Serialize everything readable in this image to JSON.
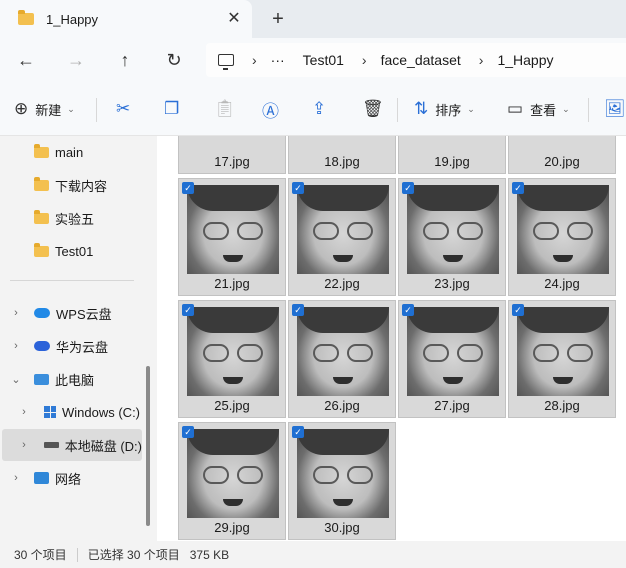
{
  "tab": {
    "title": "1_Happy",
    "close": "✕",
    "new_tab": "+"
  },
  "nav": {
    "back": "←",
    "forward": "→",
    "up": "↑",
    "refresh": "↻"
  },
  "breadcrumb": {
    "more": "···",
    "items": [
      "Test01",
      "face_dataset",
      "1_Happy"
    ],
    "separator": "›"
  },
  "toolbar": {
    "new_label": "新建",
    "sort_label": "排序",
    "view_label": "查看"
  },
  "sidebar": {
    "folders": [
      "main",
      "下载内容",
      "实验五",
      "Test01"
    ],
    "nodes": [
      {
        "label": "WPS云盘",
        "expand": "›"
      },
      {
        "label": "华为云盘",
        "expand": "›"
      },
      {
        "label": "此电脑",
        "expand": "⌄"
      },
      {
        "label": "Windows (C:)",
        "expand": "›"
      },
      {
        "label": "本地磁盘 (D:)",
        "expand": "›"
      },
      {
        "label": "网络",
        "expand": "›"
      }
    ]
  },
  "files": {
    "top_row": [
      "17.jpg",
      "18.jpg",
      "19.jpg",
      "20.jpg"
    ],
    "items": [
      "21.jpg",
      "22.jpg",
      "23.jpg",
      "24.jpg",
      "25.jpg",
      "26.jpg",
      "27.jpg",
      "28.jpg",
      "29.jpg",
      "30.jpg"
    ],
    "check": "✓"
  },
  "status": {
    "count": "30 个项目",
    "selected": "已选择 30 个项目",
    "size": "375 KB"
  }
}
